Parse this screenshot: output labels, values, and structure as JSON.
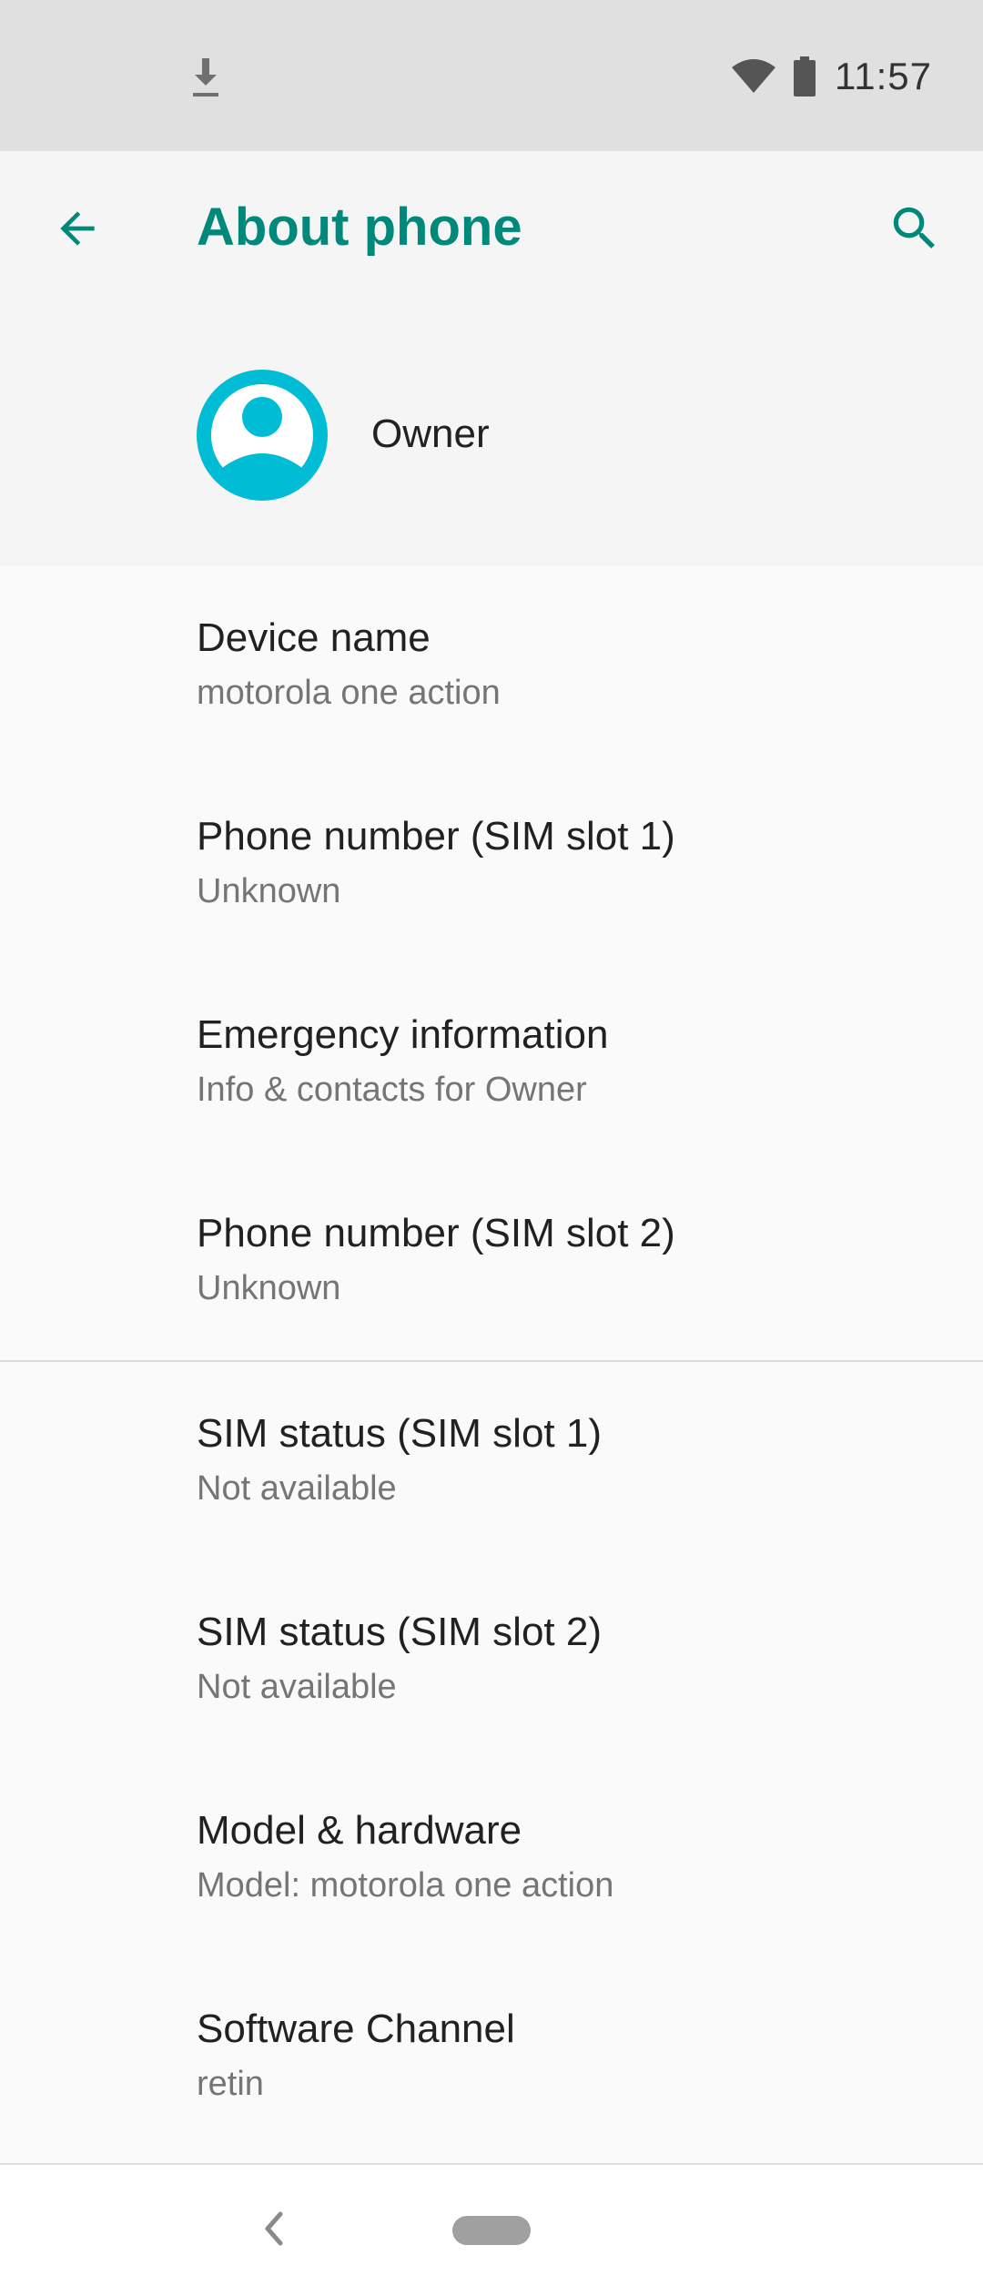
{
  "status_bar": {
    "time": "11:57",
    "icons": [
      "download-icon",
      "wifi-icon",
      "battery-icon"
    ]
  },
  "header": {
    "title": "About phone",
    "back_icon": "arrow-back-icon",
    "search_icon": "search-icon",
    "accent_color": "#00897b"
  },
  "profile": {
    "name": "Owner",
    "avatar_icon": "account-circle-icon",
    "avatar_color": "#00bcd4"
  },
  "items": [
    {
      "title": "Device name",
      "subtitle": "motorola one action"
    },
    {
      "title": "Phone number (SIM slot 1)",
      "subtitle": "Unknown"
    },
    {
      "title": "Emergency information",
      "subtitle": "Info & contacts for Owner"
    },
    {
      "title": "Phone number (SIM slot 2)",
      "subtitle": "Unknown"
    },
    {
      "title": "SIM status (SIM slot 1)",
      "subtitle": "Not available"
    },
    {
      "title": "SIM status (SIM slot 2)",
      "subtitle": "Not available"
    },
    {
      "title": "Model & hardware",
      "subtitle": "Model: motorola one action"
    },
    {
      "title": "Software Channel",
      "subtitle": "retin"
    }
  ],
  "nav_bar": {
    "back_icon": "nav-back-icon",
    "home_icon": "home-pill-icon"
  }
}
